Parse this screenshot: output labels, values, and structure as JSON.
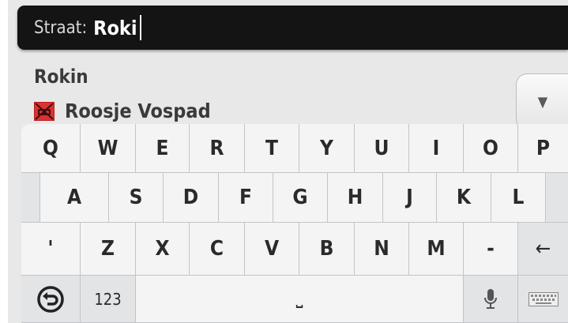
{
  "search": {
    "label": "Straat:",
    "value": "Roki"
  },
  "results": [
    {
      "name": "Rokin",
      "icon": "none"
    },
    {
      "name": "Roosje Vospad",
      "icon": "closed-road-icon"
    }
  ],
  "scroll_button": {
    "icon": "chevron-down-icon",
    "glyph": "▼"
  },
  "keyboard": {
    "row1": [
      "Q",
      "W",
      "E",
      "R",
      "T",
      "Y",
      "U",
      "I",
      "O",
      "P"
    ],
    "row2": [
      "A",
      "S",
      "D",
      "F",
      "G",
      "H",
      "J",
      "K",
      "L"
    ],
    "row3": [
      "'",
      "Z",
      "X",
      "C",
      "V",
      "B",
      "N",
      "M",
      "-"
    ],
    "backspace_glyph": "←",
    "numbers_label": "123",
    "space_glyph": "⎵",
    "back_icon": "back-icon",
    "mic_icon": "microphone-icon",
    "keyboard_icon": "keyboard-icon"
  },
  "colors": {
    "header_bg": "#141414",
    "keyboard_bg": "#c9cbce",
    "key_bg": "#f4f4f4",
    "closed_road_icon": "#e03030"
  }
}
